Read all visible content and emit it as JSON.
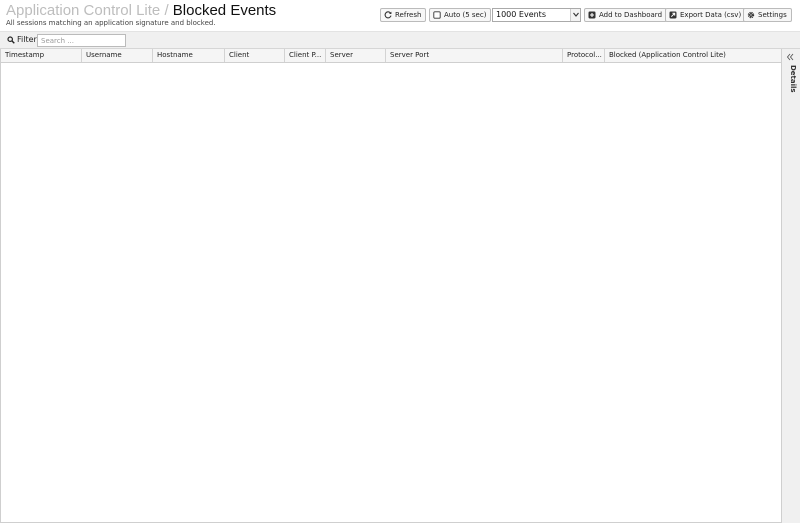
{
  "header": {
    "app_name": "Application Control Lite",
    "separator": "/",
    "page_title": "Blocked Events",
    "subtitle": "All sessions matching an application signature and blocked."
  },
  "toolbar": {
    "refresh_label": "Refresh",
    "auto_label": "Auto (5 sec)",
    "events_select_value": "1000 Events",
    "add_dashboard_label": "Add to Dashboard",
    "export_label": "Export Data (csv)",
    "settings_label": "Settings"
  },
  "filter": {
    "label": "Filter",
    "placeholder": "Search ..."
  },
  "table": {
    "columns": [
      "Timestamp",
      "Username",
      "Hostname",
      "Client",
      "Client P...",
      "Server",
      "Server Port",
      "Protocol...",
      "Blocked (Application Control Lite)"
    ],
    "rows": []
  },
  "details": {
    "label": "Details"
  },
  "icons": {
    "refresh": "refresh-icon",
    "auto": "checkbox-icon",
    "add_dashboard": "plus-square-icon",
    "export": "external-link-icon",
    "settings": "gear-icon",
    "filter": "search-icon",
    "collapse": "double-chevron-left-icon"
  }
}
